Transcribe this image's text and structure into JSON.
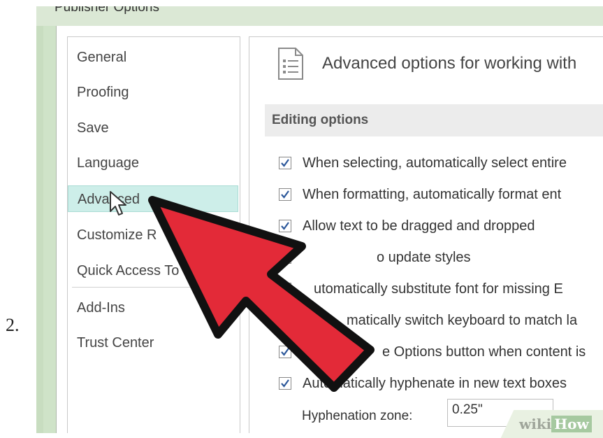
{
  "step_number": "2.",
  "window": {
    "title": "Publisher Options"
  },
  "nav": {
    "items": [
      {
        "label": "General"
      },
      {
        "label": "Proofing"
      },
      {
        "label": "Save"
      },
      {
        "label": "Language"
      },
      {
        "label": "Advanced"
      },
      {
        "label": "Customize R"
      },
      {
        "label": "Quick Access To"
      },
      {
        "label": "Add-Ins"
      },
      {
        "label": "Trust Center"
      }
    ],
    "selected": "Advanced"
  },
  "content": {
    "heading": "Advanced options for working with",
    "section_title": "Editing options",
    "options": [
      {
        "label": "When selecting, automatically select entire",
        "checked": true
      },
      {
        "label": "When formatting, automatically format ent",
        "checked": true
      },
      {
        "label": "Allow text to be dragged and dropped",
        "checked": true
      },
      {
        "label": "o update styles",
        "checked": true
      },
      {
        "label": "utomatically substitute font for missing E",
        "checked": true
      },
      {
        "label": "matically switch keyboard to match la",
        "checked": true
      },
      {
        "label": "e Options button when content is",
        "checked": true
      },
      {
        "label": "Automatically hyphenate in new text boxes",
        "checked": true
      }
    ],
    "hyphenation_zone": {
      "label": "Hyphenation zone:",
      "value": "0.25\""
    }
  },
  "watermark": {
    "wiki": "wiki",
    "how": "How"
  },
  "colors": {
    "arrow_fill": "#e32a38",
    "arrow_outline": "#111111",
    "selected_bg": "#cdeee9",
    "frame": "#cfe3c8"
  }
}
